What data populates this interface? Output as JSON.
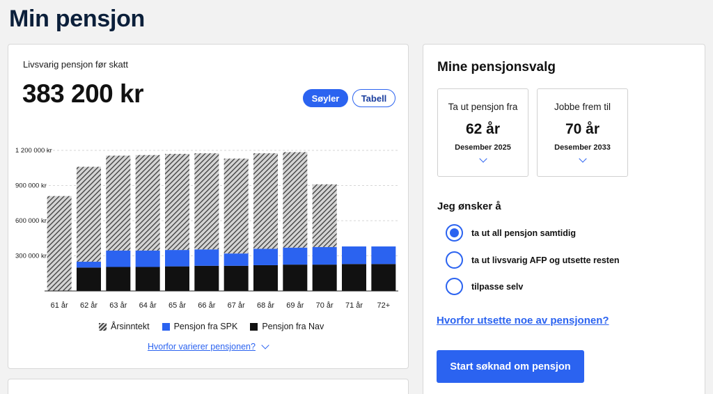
{
  "page": {
    "title": "Min pensjon"
  },
  "summary": {
    "subtitle": "Livsvarig pensjon før skatt",
    "amount": "383 200 kr",
    "toggle_bars": "Søyler",
    "toggle_table": "Tabell"
  },
  "chart_data": {
    "type": "bar",
    "stacked": true,
    "categories": [
      "61 år",
      "62 år",
      "63 år",
      "64 år",
      "65 år",
      "66 år",
      "67 år",
      "68 år",
      "69 år",
      "70 år",
      "71 år",
      "72+"
    ],
    "series": [
      {
        "name": "Pensjon fra Nav",
        "color": "#111111",
        "values": [
          0,
          200000,
          205000,
          205000,
          210000,
          215000,
          215000,
          220000,
          225000,
          225000,
          230000,
          230000
        ]
      },
      {
        "name": "Pensjon fra SPK",
        "color": "#2b63f0",
        "values": [
          0,
          50000,
          140000,
          140000,
          140000,
          140000,
          105000,
          140000,
          145000,
          150000,
          150000,
          150000
        ]
      },
      {
        "name": "Årsinntekt",
        "color": "hatched",
        "values": [
          810000,
          810000,
          810000,
          815000,
          820000,
          820000,
          810000,
          815000,
          815000,
          535000,
          0,
          0
        ]
      }
    ],
    "y_ticks": [
      "1 200 000 kr",
      "900 000 kr",
      "600 000 kr",
      "300 000 kr"
    ],
    "y_tick_values": [
      1200000,
      900000,
      600000,
      300000
    ],
    "ylim": [
      0,
      1200000
    ],
    "grid": true,
    "legend_position": "bottom"
  },
  "legend": {
    "income": "Årsinntekt",
    "spk": "Pensjon fra SPK",
    "nav": "Pensjon fra Nav"
  },
  "links": {
    "why_varies": "Hvorfor varierer pensjonen?",
    "why_postpone": "Hvorfor utsette noe av pensjonen?"
  },
  "choices": {
    "title": "Mine pensjonsvalg",
    "withdraw": {
      "label": "Ta ut pensjon fra",
      "value": "62 år",
      "date": "Desember 2025"
    },
    "work": {
      "label": "Jobbe frem til",
      "value": "70 år",
      "date": "Desember 2033"
    },
    "want_title": "Jeg ønsker å",
    "options": [
      {
        "label": "ta ut all pensjon samtidig",
        "checked": true
      },
      {
        "label": "ta ut livsvarig AFP og utsette resten",
        "checked": false
      },
      {
        "label": "tilpasse selv",
        "checked": false
      }
    ],
    "start_button": "Start søknad om pensjon"
  }
}
